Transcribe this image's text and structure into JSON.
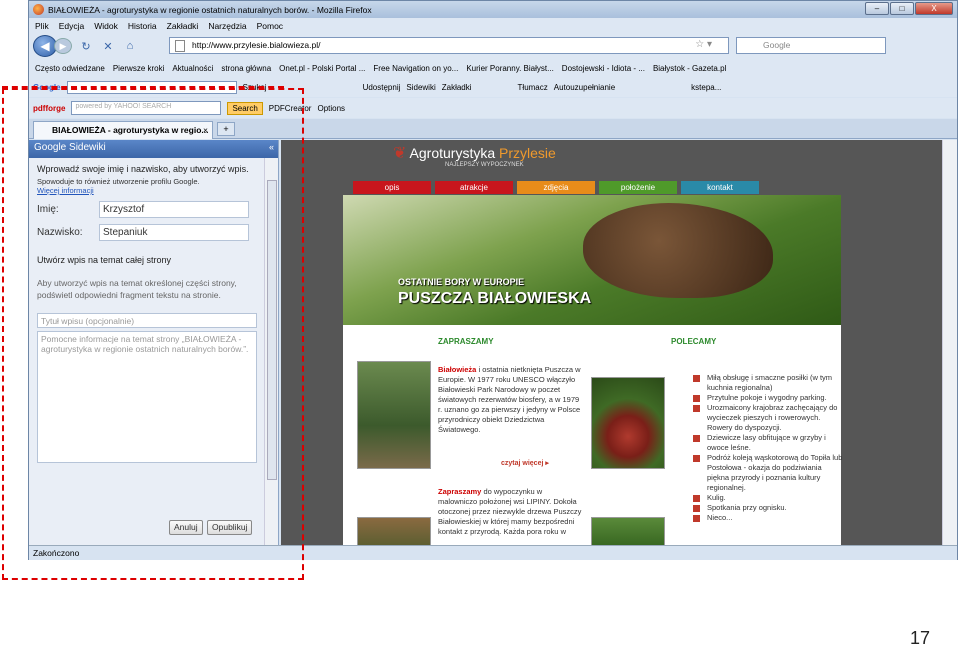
{
  "window": {
    "title": "BIAŁOWIEŻA - agroturystyka w regionie ostatnich naturalnych borów. - Mozilla Firefox",
    "controls": [
      "–",
      "□",
      "X"
    ]
  },
  "menu": [
    "Plik",
    "Edycja",
    "Widok",
    "Historia",
    "Zakładki",
    "Narzędzia",
    "Pomoc"
  ],
  "nav": {
    "url": "http://www.przylesie.bialowieza.pl/",
    "search_placeholder": "Google"
  },
  "bookmarks": [
    "Często odwiedzane",
    "Pierwsze kroki",
    "Aktualności",
    "strona główna",
    "Onet.pl - Polski Portal ...",
    "Free Navigation on yo...",
    "Kurier Poranny. Białyst...",
    "Dostojewski - Idiota - ...",
    "Białystok - Gazeta.pl"
  ],
  "google_toolbar": {
    "logo": "Google",
    "search_btn": "Szukaj",
    "items": [
      "Udostępnij",
      "Sidewiki",
      "Zakładki",
      "Tłumacz",
      "Autouzupełnianie",
      "kstepa..."
    ]
  },
  "yahoo_toolbar": {
    "brand": "pdfforge",
    "search_placeholder": "powered by YAHOO! SEARCH",
    "search_btn": "Search",
    "pdf": "PDFCreator",
    "options": "Options"
  },
  "tab": {
    "label": "BIAŁOWIEŻA - agroturystyka w regio...",
    "close": "×",
    "new": "+"
  },
  "sidebar": {
    "title": "Google Sidewiki",
    "intro": "Wprowadź swoje imię i nazwisko, aby utworzyć wpis.",
    "profile_note": "Spowoduje to również utworzenie profilu Google.",
    "more": "Więcej informacji",
    "first_name_label": "Imię:",
    "first_name": "Krzysztof",
    "last_name_label": "Nazwisko:",
    "last_name": "Stepaniuk",
    "whole_page": "Utwórz wpis na temat całej strony",
    "hint": "Aby utworzyć wpis na temat określonej części strony, podświetl odpowiedni fragment tekstu na stronie.",
    "entry_title_placeholder": "Tytuł wpisu (opcjonalnie)",
    "entry_body_placeholder": "Pomocne informacje na temat strony „BIAŁOWIEŻA - agroturystyka w regionie ostatnich naturalnych borów.”.",
    "cancel": "Anuluj",
    "publish": "Opublikuj"
  },
  "site": {
    "logo_part1": "Agroturystyka",
    "logo_part2": "Przylesie",
    "slogan": "NAJLEPSZY WYPOCZYNEK",
    "nav": [
      {
        "label": "opis",
        "color": "#c8161d"
      },
      {
        "label": "atrakcje",
        "color": "#c8161d"
      },
      {
        "label": "zdjęcia",
        "color": "#e88c1a"
      },
      {
        "label": "położenie",
        "color": "#4f9a2a"
      },
      {
        "label": "kontakt",
        "color": "#2a8aa8"
      }
    ],
    "hero_line1": "OSTATNIE BORY W EUROPIE",
    "hero_line2": "PUSZCZA BIAŁOWIESKA",
    "welcome_heading": "ZAPRASZAMY",
    "recommend_heading": "POLECAMY",
    "p1_bold": "Białowieża",
    "p1": " i ostatnia nietknięta Puszcza w Europie. W 1977 roku UNESCO włączyło Białowieski Park Narodowy w poczet światowych rezerwatów biosfery, a w 1979 r. uznano go za pierwszy i jedyny w Polsce przyrodniczy obiekt Dziedzictwa Światowego.",
    "read_more": "czytaj więcej ▸",
    "p2_bold": "Zapraszamy",
    "p2": " do wypoczynku w malowniczo położonej wsi LIPINY. Dokoła otoczonej przez niezwykle drzewa Puszczy Białowieskiej w której mamy bezpośredni kontakt z przyrodą. Każda pora roku w",
    "recommend": [
      "Miłą obsługę i smaczne posiłki (w tym kuchnia regionalna)",
      "Przytulne pokoje i wygodny parking.",
      "Urozmaicony krajobraz zachęcający do wycieczek pieszych i rowerowych. Rowery do dyspozycji.",
      "Dziewicze lasy obfitujące w grzyby i owoce leśne.",
      "Podróż koleją wąskotorową do Topiła lub Postołowa - okazja do podziwiania piękna przyrody i poznania kultury regionalnej.",
      "Kulig.",
      "Spotkania przy ognisku.",
      "Nieco..."
    ]
  },
  "status": "Zakończono",
  "page_number": "17"
}
